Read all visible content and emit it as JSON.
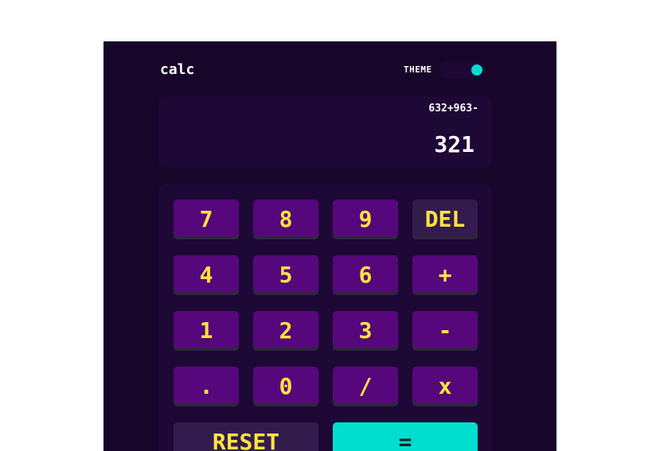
{
  "header": {
    "title": "calc",
    "theme_label": "THEME"
  },
  "display": {
    "expression": "632+963-",
    "result": "321"
  },
  "keypad": {
    "row1": [
      "7",
      "8",
      "9",
      "DEL"
    ],
    "row2": [
      "4",
      "5",
      "6",
      "+"
    ],
    "row3": [
      "1",
      "2",
      "3",
      "-"
    ],
    "row4": [
      ".",
      "0",
      "/",
      "x"
    ],
    "reset": "RESET",
    "equals": "="
  },
  "colors": {
    "background": "#17062a",
    "panel": "#1e0836",
    "key": "#56077c",
    "key_dark": "#331c4d",
    "key_text": "#ffe53d",
    "accent": "#00ded0"
  },
  "theme_toggle": {
    "position": "right"
  }
}
